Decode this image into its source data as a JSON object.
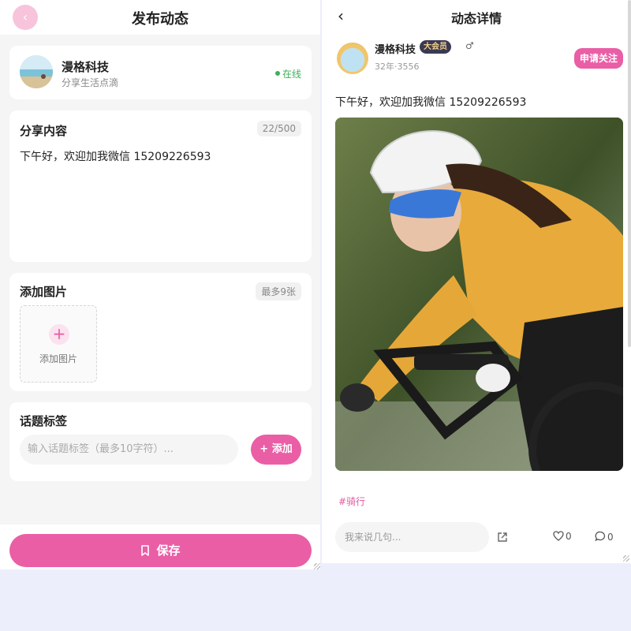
{
  "left": {
    "header": {
      "back_icon": "chevron-left-icon",
      "back_glyph": "‹",
      "title": "发布动态"
    },
    "profile": {
      "name": "漫格科技",
      "subtitle": "分享生活点滴",
      "status": "在线"
    },
    "content_section": {
      "title": "分享内容",
      "counter": "22/500",
      "text": "下午好，欢迎加我微信 15209226593"
    },
    "image_section": {
      "title": "添加图片",
      "limit": "最多9张",
      "add_glyph": "+",
      "add_label": "添加图片"
    },
    "topic_section": {
      "title": "话题标签",
      "input_placeholder": "输入话题标签（最多10字符）...",
      "add_button": "+ 添加"
    },
    "save_button": "保存"
  },
  "right": {
    "header": {
      "back_glyph": "‹",
      "title": "动态详情"
    },
    "author": {
      "name": "漫格科技",
      "badge": "大会员",
      "gender_glyph": "♂",
      "subtitle": "32年·3556"
    },
    "follow_button": "申请关注",
    "post_text": "下午好，欢迎加我微信 15209226593",
    "hashtag": "#骑行",
    "comment_placeholder": "我来说几句...",
    "likes": "0",
    "comments": "0"
  },
  "colors": {
    "accent": "#ea5ea6",
    "online": "#3db05a",
    "background": "#eceefc"
  }
}
